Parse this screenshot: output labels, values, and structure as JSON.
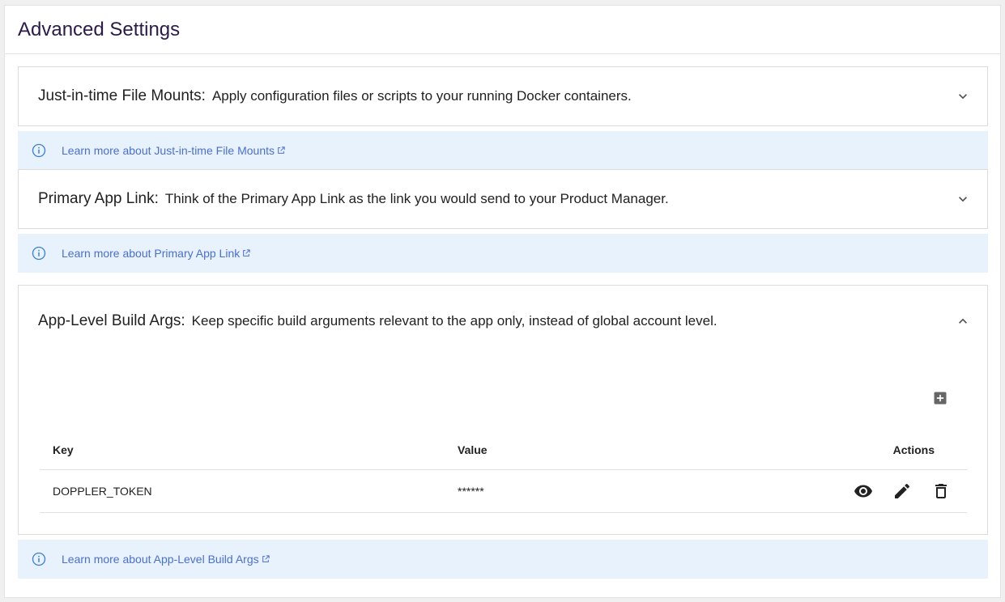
{
  "page": {
    "title": "Advanced Settings"
  },
  "panels": [
    {
      "name": "Just-in-time File Mounts:",
      "description": "Apply configuration files or scripts to your running Docker containers.",
      "expanded": false,
      "info_link": "Learn more about Just-in-time File Mounts"
    },
    {
      "name": "Primary App Link:",
      "description": "Think of the Primary App Link as the link you would send to your Product Manager.",
      "expanded": false,
      "info_link": "Learn more about Primary App Link"
    },
    {
      "name": "App-Level Build Args:",
      "description": "Keep specific build arguments relevant to the app only, instead of global account level.",
      "expanded": true,
      "info_link": "Learn more about App-Level Build Args"
    }
  ],
  "build_args_table": {
    "columns": [
      "Key",
      "Value",
      "Actions"
    ],
    "rows": [
      {
        "key": "DOPPLER_TOKEN",
        "value": "******"
      }
    ]
  },
  "icons": {
    "expand": "chevron-down-icon",
    "collapse": "chevron-up-icon",
    "info": "info-icon",
    "external": "external-link-icon",
    "add": "add-box-icon",
    "view": "eye-icon",
    "edit": "pencil-icon",
    "delete": "trash-icon"
  },
  "colors": {
    "title": "#2c1a4a",
    "info_bg": "#e8f2fc",
    "link": "#4a6fd0",
    "info_icon": "#3b7fd4"
  }
}
